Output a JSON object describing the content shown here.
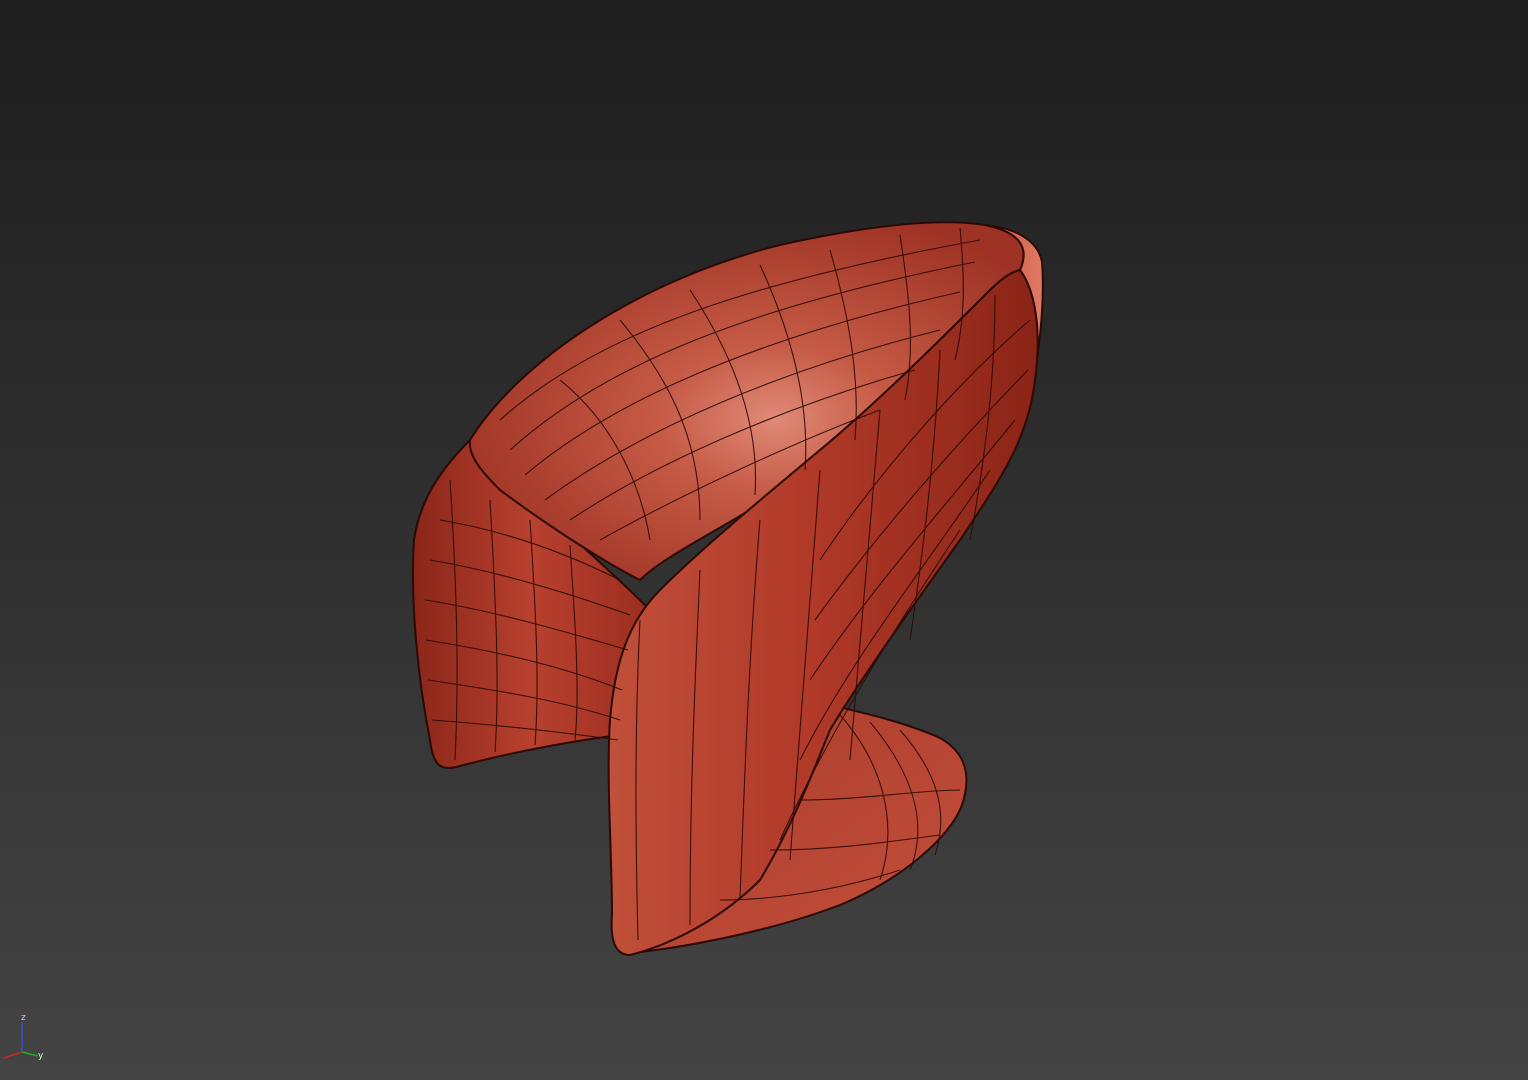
{
  "viewport": {
    "background_top": "#1e1e1e",
    "background_bottom": "#444444"
  },
  "model": {
    "icon": "chair-mesh-icon",
    "surface_color": "#b63a2b",
    "highlight_color": "#d8705e",
    "shadow_color": "#6e1d14",
    "wire_color": "#2b0a06"
  },
  "gizmo": {
    "z_label": "z",
    "y_label": "y",
    "x_color": "#d02020",
    "y_color": "#20b020",
    "z_color": "#3050e0"
  }
}
